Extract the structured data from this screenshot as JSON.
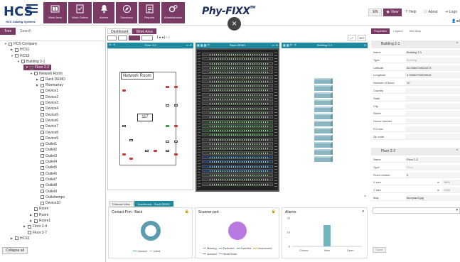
{
  "header": {
    "logo_text": "HCS Cabling Systems",
    "nav": [
      {
        "label": "Work Area",
        "icon": "work-area-icon"
      },
      {
        "label": "Work Orders",
        "icon": "work-orders-icon"
      },
      {
        "label": "Alarms",
        "icon": "alarms-icon"
      },
      {
        "label": "Discovery",
        "icon": "discovery-icon"
      },
      {
        "label": "Reports",
        "icon": "reports-icon"
      },
      {
        "label": "Administration",
        "icon": "administration-icon"
      }
    ],
    "brand": "Phy-FIXX",
    "brand_tm": "TM",
    "close_glyph": "×",
    "language": "EN",
    "view_label": "View",
    "help_label": "Help",
    "about_label": "About",
    "logout_label": "Logo",
    "user_label": "ad"
  },
  "left_panel": {
    "tabs": [
      "Tree",
      "Search"
    ],
    "collapse_label": "Collapse all",
    "tree": [
      {
        "label": "HCS Company",
        "depth": 0,
        "arrow": "▼"
      },
      {
        "label": "HCS1",
        "depth": 1,
        "arrow": "▶"
      },
      {
        "label": "HCS3",
        "depth": 1,
        "arrow": "▼"
      },
      {
        "label": "Building 2-1",
        "depth": 2,
        "arrow": "▼"
      },
      {
        "label": "Floor 2-2",
        "depth": 3,
        "arrow": "▼",
        "selected": true
      },
      {
        "label": "Network Room",
        "depth": 4,
        "arrow": "▼"
      },
      {
        "label": "Rack DEMO",
        "depth": 5,
        "arrow": "▶"
      },
      {
        "label": "Roomarray",
        "depth": 5,
        "arrow": "▶"
      },
      {
        "label": "Device1",
        "depth": 5,
        "arrow": ""
      },
      {
        "label": "Device2",
        "depth": 5,
        "arrow": ""
      },
      {
        "label": "Device3",
        "depth": 5,
        "arrow": ""
      },
      {
        "label": "Device4",
        "depth": 5,
        "arrow": ""
      },
      {
        "label": "Device5",
        "depth": 5,
        "arrow": ""
      },
      {
        "label": "Device6",
        "depth": 5,
        "arrow": ""
      },
      {
        "label": "Device7",
        "depth": 5,
        "arrow": ""
      },
      {
        "label": "Device8",
        "depth": 5,
        "arrow": ""
      },
      {
        "label": "Device9",
        "depth": 5,
        "arrow": ""
      },
      {
        "label": "Outlet1",
        "depth": 5,
        "arrow": ""
      },
      {
        "label": "Outlet2",
        "depth": 5,
        "arrow": ""
      },
      {
        "label": "Outlet3",
        "depth": 5,
        "arrow": ""
      },
      {
        "label": "Outlet4",
        "depth": 5,
        "arrow": ""
      },
      {
        "label": "Outlet5",
        "depth": 5,
        "arrow": ""
      },
      {
        "label": "Outlet6",
        "depth": 5,
        "arrow": ""
      },
      {
        "label": "Outlet7",
        "depth": 5,
        "arrow": ""
      },
      {
        "label": "Outlet8",
        "depth": 5,
        "arrow": ""
      },
      {
        "label": "Outlet9",
        "depth": 5,
        "arrow": ""
      },
      {
        "label": "Outlettempo",
        "depth": 5,
        "arrow": ""
      },
      {
        "label": "Device10",
        "depth": 5,
        "arrow": ""
      },
      {
        "label": "Room",
        "depth": 4,
        "arrow": ""
      },
      {
        "label": "Room",
        "depth": 4,
        "arrow": "▶"
      },
      {
        "label": "Room1",
        "depth": 4,
        "arrow": "▶"
      },
      {
        "label": "Floor 2-4",
        "depth": 3,
        "arrow": "▶"
      },
      {
        "label": "Floor 2-7",
        "depth": 3,
        "arrow": ""
      },
      {
        "label": "HCS3",
        "depth": 1,
        "arrow": "▶"
      }
    ]
  },
  "center": {
    "tabs": [
      "Dashboard",
      "Work Area"
    ],
    "toolbar": {
      "pager": "1 ▸ ▸|  ‹ ›",
      "wo_label": "WO"
    },
    "views": [
      {
        "title": "Floor 2-2"
      },
      {
        "title": "Rack DEMO"
      },
      {
        "title": "Building 2-1"
      }
    ],
    "floorplan_room_label": "Network Room",
    "floorplan_bed_label": "117",
    "lower_tabs": [
      "Channel View",
      "Dashboard - Rack DEMO"
    ],
    "widgets": {
      "contact_port": {
        "title": "Contact Port - Back",
        "legend": [
          "Unused",
          "Used"
        ],
        "colors": {
          "unused": "#5b9bb0",
          "used": "#d8d8d8"
        }
      },
      "scanner_port": {
        "title": "Scanner port",
        "legend": [
          "Missing",
          "Detected",
          "Patched",
          "Unscanned",
          "Unused",
          "WorkOrder"
        ],
        "color": "#b87ae0"
      }
    }
  },
  "chart_data": {
    "type": "bar",
    "title": "Alarms",
    "categories": [
      "Closed",
      "New",
      "Open"
    ],
    "values": [
      0,
      15,
      0
    ],
    "ylim": [
      0,
      20
    ],
    "yticks": [
      0,
      10,
      20
    ],
    "ytick_labels": [
      "0",
      "10",
      "20"
    ],
    "grid": false,
    "color": "#6fb6c0"
  },
  "right_panel": {
    "tabs": [
      "Properties",
      "Legend",
      "Mini Map"
    ],
    "building": {
      "header": "Building 2-1",
      "rows": [
        {
          "key": "Name",
          "value": "Building 2-1"
        },
        {
          "key": "Type",
          "value": "Building",
          "disabled": true
        },
        {
          "key": "Latitude",
          "value": "52.0066749520373"
        },
        {
          "key": "Longitude",
          "value": "4.95669700639516"
        },
        {
          "key": "Number of floors",
          "value": "12"
        },
        {
          "key": "Country",
          "value": ""
        },
        {
          "key": "State",
          "value": ""
        },
        {
          "key": "City",
          "value": ""
        },
        {
          "key": "Street",
          "value": ""
        },
        {
          "key": "House number",
          "value": ""
        },
        {
          "key": "P.O.box",
          "value": ""
        },
        {
          "key": "Zip code",
          "value": ""
        }
      ]
    },
    "floor": {
      "header": "Floor 2-2",
      "rows": [
        {
          "key": "Name",
          "value": "Floor 2-2"
        },
        {
          "key": "Type",
          "value": "Floor",
          "disabled": true
        },
        {
          "key": "Floor number",
          "value": "2"
        },
        {
          "key": "X size",
          "value": "m",
          "value2": "1600"
        },
        {
          "key": "Y size",
          "value": "m",
          "value2": "1200"
        },
        {
          "key": "Map",
          "value": "floorplan3.jpg"
        }
      ]
    },
    "save_label": "Save"
  },
  "colors": {
    "accent": "#7a3a63",
    "view_header": "#1e8aa0",
    "rack_bg": "#222222",
    "building_floor": "#8ab6c4"
  }
}
